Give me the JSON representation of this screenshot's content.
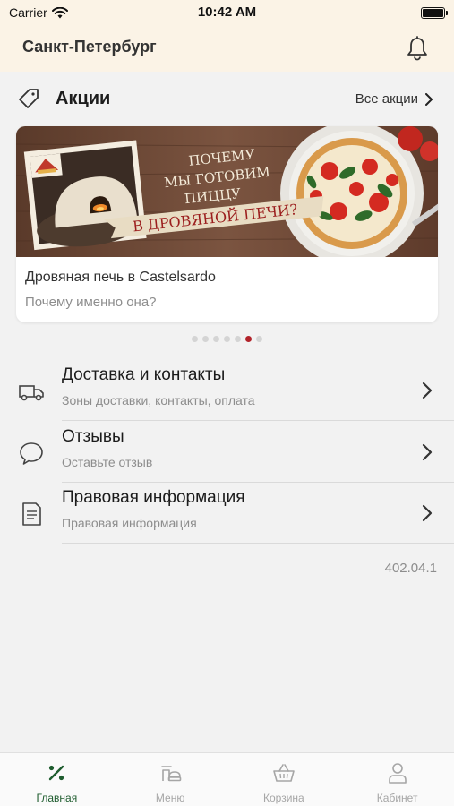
{
  "status_bar": {
    "carrier": "Carrier",
    "time": "10:42 AM"
  },
  "header": {
    "city": "Санкт-Петербург"
  },
  "promos": {
    "title": "Акции",
    "all_link": "Все акции",
    "card": {
      "banner_line1": "ПОЧЕМУ",
      "banner_line2": "МЫ ГОТОВИМ",
      "banner_line3": "ПИЦЦУ",
      "banner_ribbon": "В ДРОВЯНОЙ ПЕЧИ?",
      "title": "Дровяная печь в Castelsardo",
      "subtitle": "Почему именно она?"
    },
    "dots_total": 7,
    "dots_active_index": 5
  },
  "menu": [
    {
      "label": "Доставка и контакты",
      "sub": "Зоны доставки, контакты, оплата",
      "icon": "truck-icon"
    },
    {
      "label": "Отзывы",
      "sub": "Оставьте отзыв",
      "icon": "speech-bubble-icon"
    },
    {
      "label": "Правовая информация",
      "sub": "Правовая информация",
      "icon": "document-icon"
    }
  ],
  "version": "402.04.1",
  "tabs": [
    {
      "label": "Главная",
      "icon": "home-percent-icon",
      "active": true
    },
    {
      "label": "Меню",
      "icon": "menu-dish-icon",
      "active": false
    },
    {
      "label": "Корзина",
      "icon": "basket-icon",
      "active": false
    },
    {
      "label": "Кабинет",
      "icon": "user-icon",
      "active": false
    }
  ],
  "colors": {
    "header_bg": "#fbf3e6",
    "accent_red": "#b2232a",
    "active_tab_green": "#1e5c2e"
  }
}
